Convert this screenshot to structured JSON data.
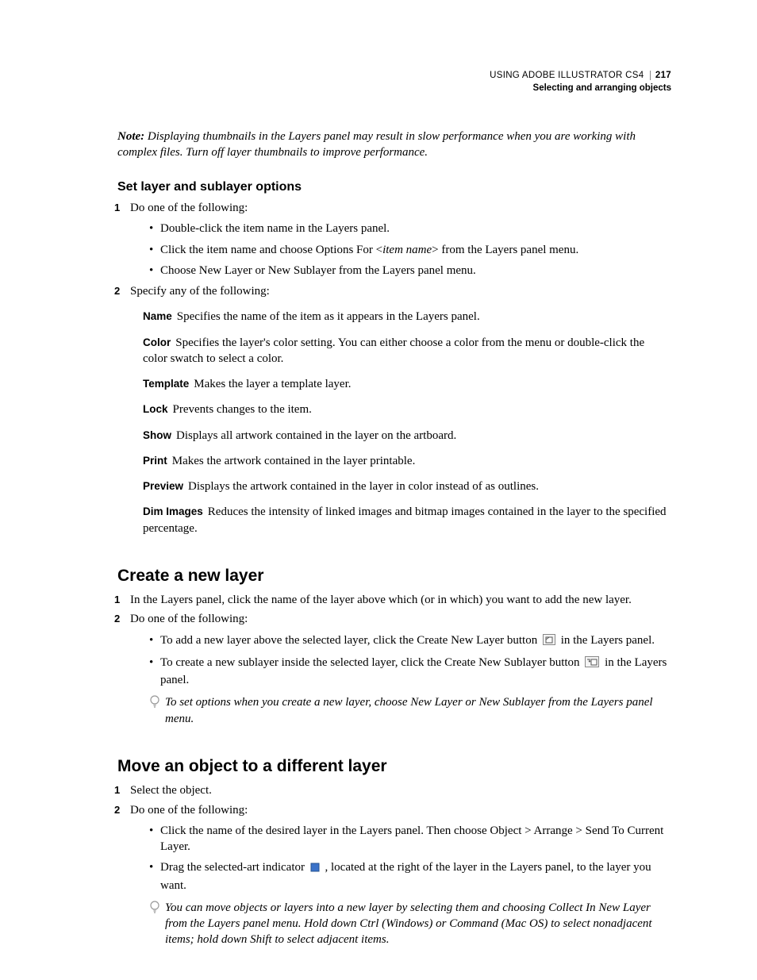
{
  "header": {
    "product": "USING ADOBE ILLUSTRATOR CS4",
    "page_number": "217",
    "chapter": "Selecting and arranging objects"
  },
  "note": {
    "label": "Note:",
    "text": "Displaying thumbnails in the Layers panel may result in slow performance when you are working with complex files. Turn off layer thumbnails to improve performance."
  },
  "section1": {
    "title": "Set layer and sublayer options",
    "step1": "Do one of the following:",
    "bullets": [
      "Double-click the item name in the Layers panel.",
      "Click the item name and choose Options For <item name> from the Layers panel menu.",
      "Choose New Layer or New Sublayer from the Layers panel menu."
    ],
    "step2": "Specify any of the following:",
    "defs": [
      {
        "term": "Name",
        "desc": "Specifies the name of the item as it appears in the Layers panel."
      },
      {
        "term": "Color",
        "desc": "Specifies the layer's color setting. You can either choose a color from the menu or double-click the color swatch to select a color."
      },
      {
        "term": "Template",
        "desc": "Makes the layer a template layer."
      },
      {
        "term": "Lock",
        "desc": "Prevents changes to the item."
      },
      {
        "term": "Show",
        "desc": "Displays all artwork contained in the layer on the artboard."
      },
      {
        "term": "Print",
        "desc": "Makes the artwork contained in the layer printable."
      },
      {
        "term": "Preview",
        "desc": "Displays the artwork contained in the layer in color instead of as outlines."
      },
      {
        "term": "Dim Images",
        "desc": "Reduces the intensity of linked images and bitmap images contained in the layer to the specified percentage."
      }
    ]
  },
  "section2": {
    "title": "Create a new layer",
    "step1": "In the Layers panel, click the name of the layer above which (or in which) you want to add the new layer.",
    "step2": "Do one of the following:",
    "b1a": "To add a new layer above the selected layer, click the Create New Layer button ",
    "b1b": " in the Layers panel.",
    "b2a": "To create a new sublayer inside the selected layer, click the Create New Sublayer button ",
    "b2b": " in the Layers panel.",
    "tip": "To set options when you create a new layer, choose New Layer or New Sublayer from the Layers panel menu."
  },
  "section3": {
    "title": "Move an object to a different layer",
    "step1": "Select the object.",
    "step2": "Do one of the following:",
    "b1": "Click the name of the desired layer in the Layers panel. Then choose Object > Arrange > Send To Current Layer.",
    "b2a": "Drag the selected-art indicator ",
    "b2b": ", located at the right of the layer in the Layers panel, to the layer you want.",
    "tip": "You can move objects or layers into a new layer by selecting them and choosing Collect In New Layer from the Layers panel menu. Hold down Ctrl (Windows) or Command (Mac OS) to select nonadjacent items; hold down Shift to select adjacent items."
  }
}
